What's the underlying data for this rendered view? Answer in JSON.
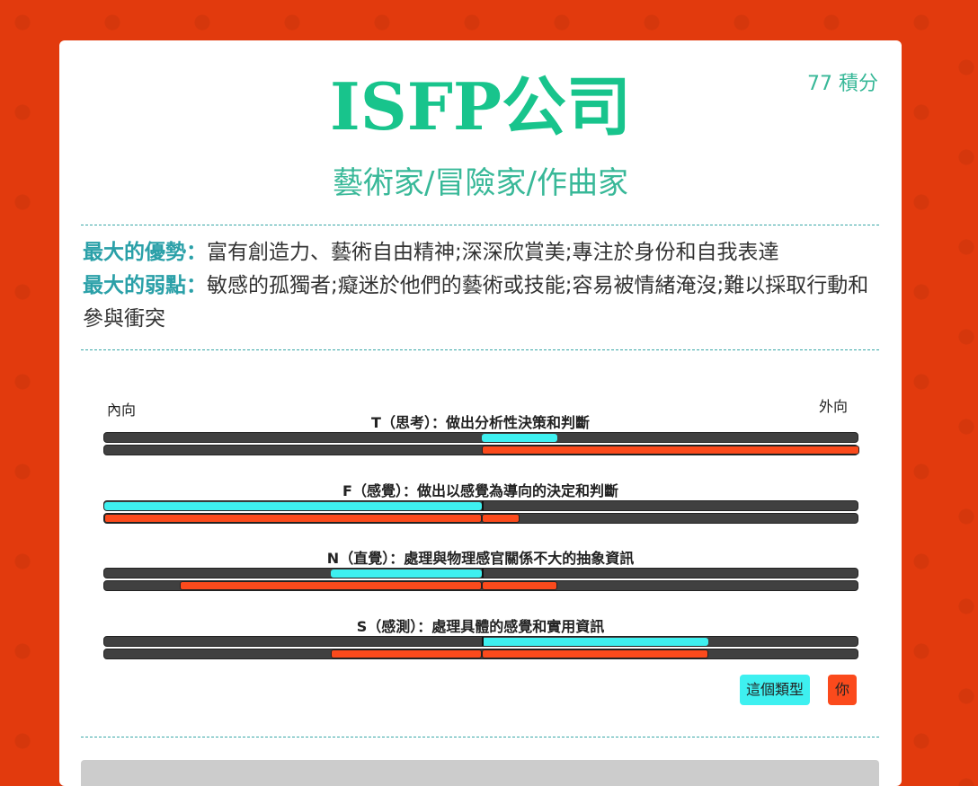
{
  "header": {
    "points": "77 積分",
    "title": "ISFP公司",
    "subtitle": "藝術家/冒險家/作曲家"
  },
  "traits": {
    "strength_label": "最大的優勢：",
    "strength_text": "富有創造力、藝術自由精神;深深欣賞美;專注於身份和自我表達",
    "weakness_label": "最大的弱點：",
    "weakness_text": "敏感的孤獨者;癡迷於他們的藝術或技能;容易被情緒淹沒;難以採取行動和參與衝突"
  },
  "chart_data": {
    "type": "bar",
    "left_label": "內向",
    "right_label": "外向",
    "legend": {
      "type_label": "這個類型",
      "you_label": "你",
      "type_color": "#3ef0f0",
      "you_color": "#fb4a1c"
    },
    "range": [
      -100,
      100
    ],
    "dimensions": [
      {
        "label": "T（思考）：做出分析性決策和判斷",
        "type_value": 20,
        "you_value": 100
      },
      {
        "label": "F（感覺）：做出以感覺為導向的決定和判斷",
        "type_value": -100,
        "you_value": -100,
        "you_value_right": 10
      },
      {
        "label": "N（直覺）：處理與物理感官關係不大的抽象資訊",
        "type_value": -40,
        "you_value": -80,
        "you_value_right": 20
      },
      {
        "label": "S（感測）：處理具體的感覺和實用資訊",
        "type_value": 60,
        "you_value": -40,
        "you_value_right": 60
      }
    ]
  }
}
